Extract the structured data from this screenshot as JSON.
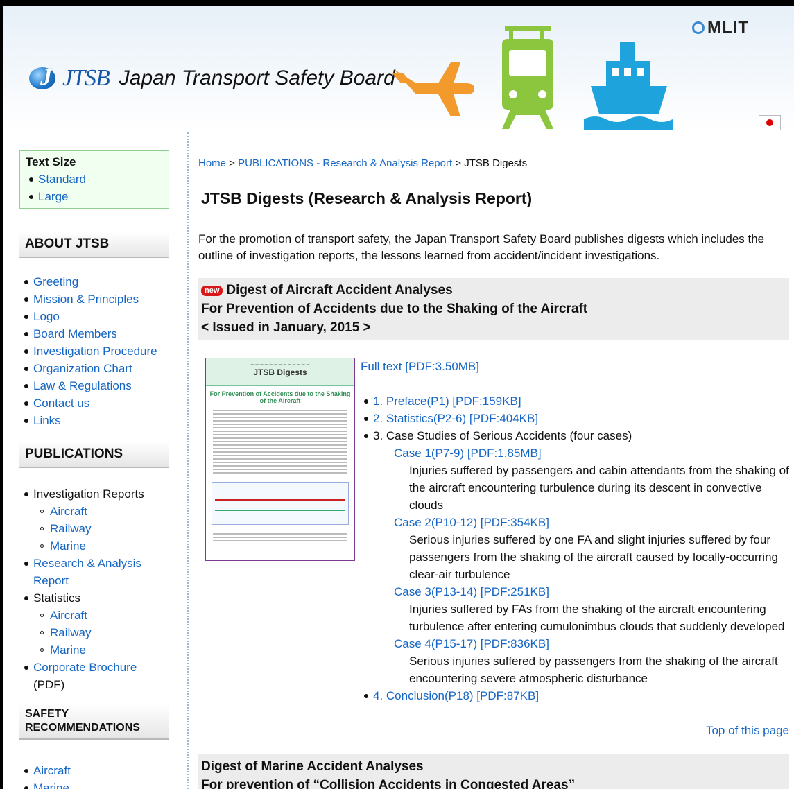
{
  "header": {
    "logo_abbr": "JTSB",
    "logo_name": "Japan Transport Safety Board",
    "ministry": "MLIT",
    "icons": [
      "airplane-icon",
      "train-icon",
      "ship-icon"
    ],
    "colors": {
      "airplane": "#f39a2d",
      "train": "#8cc63f",
      "ship": "#1fa3dc"
    }
  },
  "sidebar": {
    "text_size": {
      "title": "Text Size",
      "options": [
        "Standard",
        "Large"
      ]
    },
    "about": {
      "title": "ABOUT JTSB",
      "items": [
        "Greeting",
        "Mission & Principles",
        "Logo",
        "Board Members",
        "Investigation Procedure",
        "Organization Chart",
        "Law & Regulations",
        "Contact us",
        "Links"
      ]
    },
    "publications": {
      "title": "PUBLICATIONS",
      "investigation_reports": "Investigation Reports",
      "investigation_sub": [
        "Aircraft",
        "Railway",
        "Marine"
      ],
      "research": [
        "Research & Analysis",
        "Report"
      ],
      "statistics": "Statistics",
      "statistics_sub": [
        "Aircraft",
        "Railway",
        "Marine"
      ],
      "brochure_link": "Corporate Brochure",
      "brochure_suffix": "(PDF)"
    },
    "safety": {
      "title_line1": "SAFETY",
      "title_line2": "RECOMMENDATIONS",
      "items": [
        "Aircraft",
        "Marine"
      ]
    }
  },
  "main": {
    "breadcrumb": {
      "home": "Home",
      "sep": " > ",
      "publications": "PUBLICATIONS - Research & Analysis Report",
      "current": "JTSB Digests"
    },
    "title": "JTSB Digests (Research & Analysis Report)",
    "intro": "For the promotion of transport safety, the Japan Transport Safety Board publishes digests which includes the outline of investigation reports, the lessons learned from accident/incident investigations.",
    "digest1": {
      "badge": "new",
      "title": "Digest of Aircraft Accident Analyses",
      "subtitle": "For Prevention of Accidents due to the Shaking of the Aircraft",
      "issued": "< Issued in January, 2015 >",
      "cover": {
        "header": "JTSB Digests",
        "title": "For Prevention of Accidents due to the Shaking of the Aircraft"
      },
      "full_text": "Full text [PDF:3.50MB]",
      "sections": {
        "s1": "1. Preface(P1) [PDF:159KB]",
        "s2": "2. Statistics(P2-6) [PDF:404KB]",
        "s3": "3. Case Studies of Serious Accidents (four cases)",
        "s4": "4. Conclusion(P18) [PDF:87KB]"
      },
      "cases": [
        {
          "link": "Case 1(P7-9) [PDF:1.85MB]",
          "desc": "Injuries suffered by passengers and cabin attendants from the shaking of the aircraft encountering turbulence during its descent in convective clouds"
        },
        {
          "link": "Case 2(P10-12) [PDF:354KB]",
          "desc": "Serious injuries suffered by one FA and slight injuries suffered by four passengers from the shaking of the aircraft caused by locally-occurring clear-air turbulence"
        },
        {
          "link": "Case 3(P13-14) [PDF:251KB]",
          "desc": "Injuries suffered by FAs from the shaking of the aircraft encountering turbulence after entering cumulonimbus clouds that suddenly developed"
        },
        {
          "link": "Case 4(P15-17) [PDF:836KB]",
          "desc": "Serious injuries suffered by passengers from the shaking of the aircraft encountering severe atmospheric disturbance"
        }
      ]
    },
    "top_link": "Top of this page",
    "digest2": {
      "title": "Digest of Marine Accident Analyses",
      "subtitle": "For prevention of “Collision Accidents in Congested Areas”"
    }
  }
}
